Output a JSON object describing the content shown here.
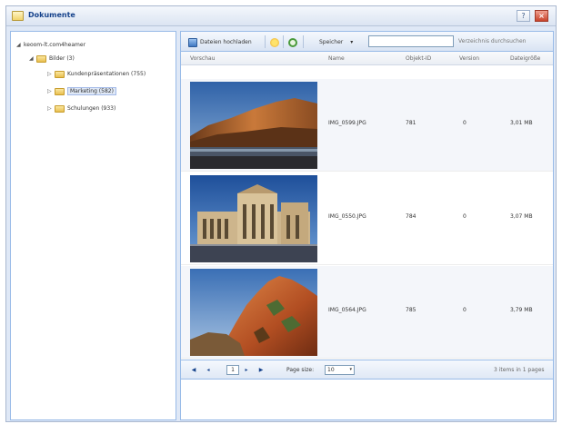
{
  "window": {
    "title": "Dokumente",
    "help_label": "?",
    "close_label": "×"
  },
  "tree": {
    "root": {
      "toggle": "◢",
      "label": "keoom-lt.com4heamer"
    },
    "bilder": {
      "toggle": "◢",
      "label": "Bilder (3)"
    },
    "children": [
      {
        "toggle": "▷",
        "label": "Kundenpräsentationen (755)"
      },
      {
        "toggle": "▷",
        "label": "Marketing (582)"
      },
      {
        "toggle": "▷",
        "label": "Schulungen (933)"
      }
    ]
  },
  "toolbar": {
    "upload_label": "Dateien hochladen",
    "save_label": "Speicher",
    "save_arrow": "▾",
    "search_value": "",
    "search_hint": "Verzeichnis durchsuchen"
  },
  "columns": [
    "Vorschau",
    "Name",
    "Objekt-ID",
    "Version",
    "Dateigröße"
  ],
  "rows": [
    {
      "name": "IMG_0599.JPG",
      "id": "781",
      "version": "0",
      "size": "3,01 MB"
    },
    {
      "name": "IMG_0550.JPG",
      "id": "784",
      "version": "0",
      "size": "3,07 MB"
    },
    {
      "name": "IMG_0564.JPG",
      "id": "785",
      "version": "0",
      "size": "3,79 MB"
    }
  ],
  "pager": {
    "first": "◀",
    "prev": "◂",
    "page": "1",
    "next": "▸",
    "last": "▶",
    "page_size_label": "Page size:",
    "page_size_value": "10",
    "page_size_arrow": "▾",
    "summary": "3 items in 1 pages"
  }
}
